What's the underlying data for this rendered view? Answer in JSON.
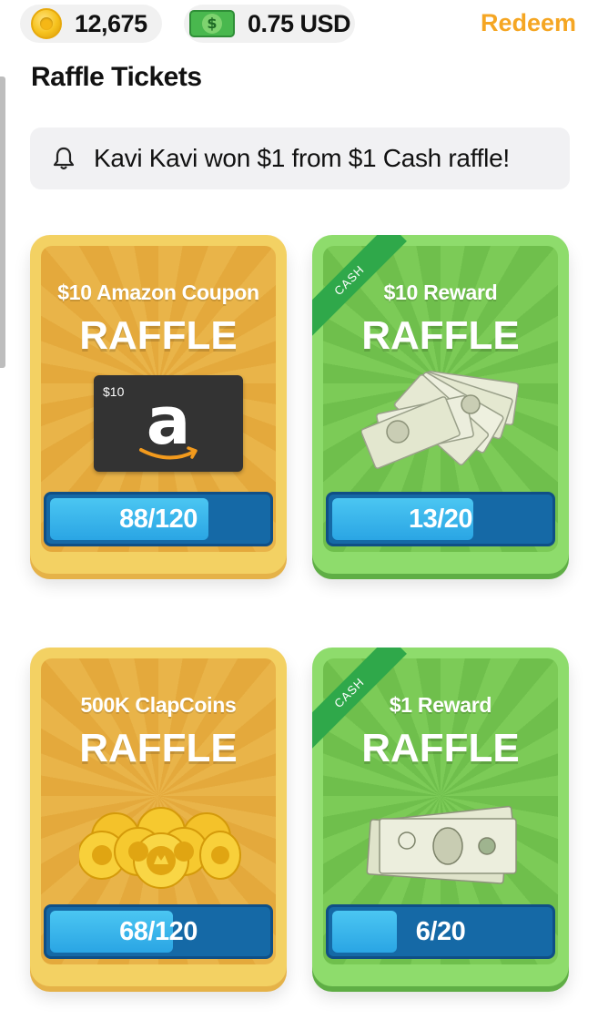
{
  "header": {
    "coins_value": "12,675",
    "cash_value": "0.75 USD",
    "redeem_label": "Redeem"
  },
  "page_title": "Raffle Tickets",
  "notification": {
    "text": "Kavi Kavi won $1 from $1 Cash raffle!"
  },
  "cards": [
    {
      "subtitle": "$10 Amazon Coupon",
      "title": "RAFFLE",
      "art": "amazon-gift-card",
      "art_amount": "$10",
      "progress_label": "88/120",
      "progress_fraction": 0.733,
      "theme": "gold",
      "ribbon": ""
    },
    {
      "subtitle": "$10 Reward",
      "title": "RAFFLE",
      "art": "cash-stack",
      "progress_label": "13/20",
      "progress_fraction": 0.65,
      "theme": "green",
      "ribbon": "CASH"
    },
    {
      "subtitle": "500K ClapCoins",
      "title": "RAFFLE",
      "art": "coin-stack",
      "progress_label": "68/120",
      "progress_fraction": 0.567,
      "theme": "gold",
      "ribbon": ""
    },
    {
      "subtitle": "$1 Reward",
      "title": "RAFFLE",
      "art": "dollar-bills",
      "progress_label": "6/20",
      "progress_fraction": 0.3,
      "theme": "green",
      "ribbon": "CASH"
    }
  ],
  "colors": {
    "accent": "#f5a623",
    "gold_card": "#f3d163",
    "green_card": "#8edc6c",
    "progress_track": "#1569a6",
    "progress_fill": "#2aa5e4"
  }
}
